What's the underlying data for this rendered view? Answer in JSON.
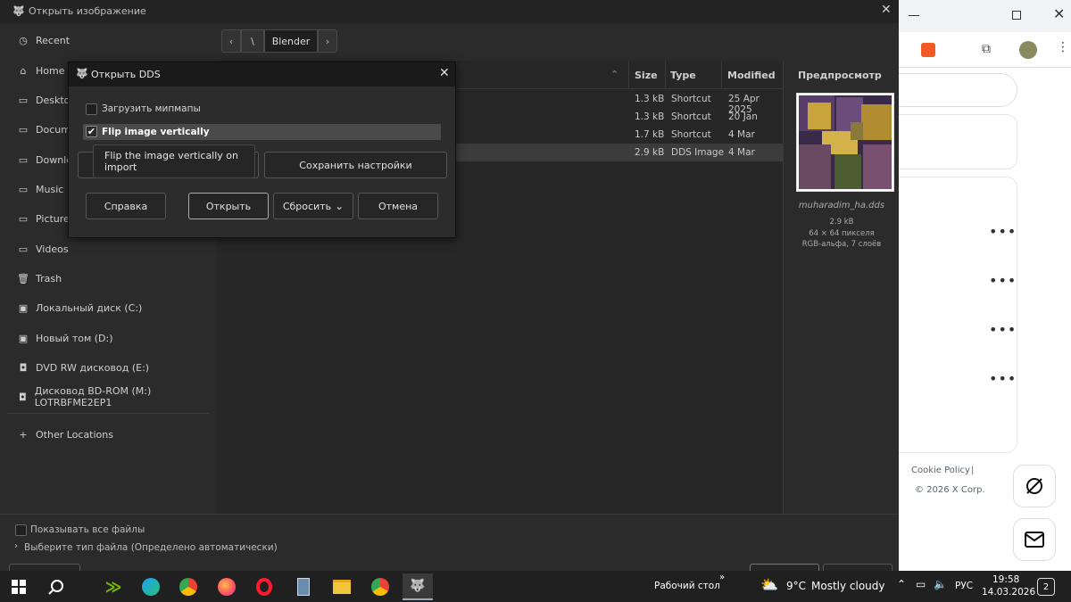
{
  "window": {
    "title": "Открыть изображение"
  },
  "sidebar": {
    "items": [
      {
        "label": "Recent",
        "icon": "clock-icon"
      },
      {
        "label": "Home",
        "icon": "home-icon"
      },
      {
        "label": "Desktop",
        "icon": "folder-icon"
      },
      {
        "label": "Documents",
        "icon": "folder-icon"
      },
      {
        "label": "Downloads",
        "icon": "folder-icon"
      },
      {
        "label": "Music",
        "icon": "folder-icon"
      },
      {
        "label": "Pictures",
        "icon": "folder-icon"
      },
      {
        "label": "Videos",
        "icon": "folder-icon"
      },
      {
        "label": "Trash",
        "icon": "trash-icon"
      },
      {
        "label": "Локальный диск (C:)",
        "icon": "drive-icon"
      },
      {
        "label": "Новый том (D:)",
        "icon": "drive-icon"
      },
      {
        "label": "DVD RW дисковод (E:)",
        "icon": "optical-drive-icon"
      },
      {
        "label": "Дисковод BD-ROM (M:) LOTRBFME2EP1",
        "icon": "optical-drive-icon"
      },
      {
        "label": "Other Locations",
        "icon": "plus-icon"
      }
    ]
  },
  "pathbar": {
    "segments": [
      "\\",
      "Blender"
    ]
  },
  "filelist": {
    "columns": {
      "size": "Size",
      "type": "Type",
      "modified": "Modified"
    },
    "rows": [
      {
        "size": "1.3 kB",
        "type": "Shortcut",
        "modified": "25 Apr 2025"
      },
      {
        "size": "1.3 kB",
        "type": "Shortcut",
        "modified": "20 Jan"
      },
      {
        "size": "1.7 kB",
        "type": "Shortcut",
        "modified": "4 Mar"
      },
      {
        "size": "2.9 kB",
        "type": "DDS Image",
        "modified": "4 Mar"
      }
    ]
  },
  "preview": {
    "title": "Предпросмотр",
    "filename": "muharadim_ha.dds",
    "size": "2.9 kB",
    "dims": "64 × 64 пикселя",
    "info": "RGB-альфа, 7 слоёв"
  },
  "bottom": {
    "show_all": "Показывать все файлы",
    "filetype": "Выберите тип файла (Определено автоматически)"
  },
  "dds_dialog": {
    "title": "Открыть DDS",
    "load_mipmaps": "Загрузить мипмапы",
    "load_mipmaps_checked": false,
    "flip_label": "Flip image vertically",
    "flip_checked": true,
    "save_settings": "Сохранить настройки",
    "help": "Справка",
    "open": "Открыть",
    "reset": "Сбросить",
    "cancel": "Отмена",
    "tooltip": "Flip the image vertically on import"
  },
  "browser": {
    "footer": {
      "cookie": "Cookie Policy",
      "sep": "|",
      "copyright": "© 2026 X Corp."
    }
  },
  "taskbar": {
    "desktop_label": "Рабочий стол",
    "weather_temp": "9°C",
    "weather_desc": "Mostly cloudy",
    "lang": "РУС",
    "time": "19:58",
    "date": "14.03.2026",
    "notif_count": "2"
  },
  "colors": {
    "accent_green": "#76b900",
    "selection": "#3c3c3c",
    "taskbar": "#202020"
  }
}
